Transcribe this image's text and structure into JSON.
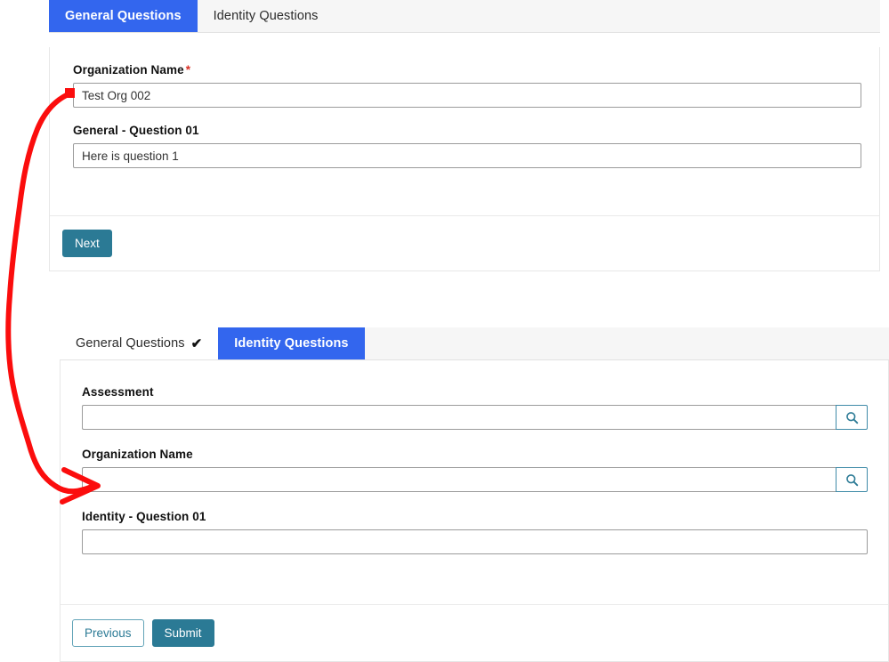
{
  "steps": [
    {
      "id": "general",
      "tabs": [
        {
          "label": "General Questions",
          "state": "active",
          "check": ""
        },
        {
          "label": "Identity Questions",
          "state": "inactive",
          "check": ""
        }
      ],
      "fields": [
        {
          "label": "Organization Name",
          "required": true,
          "required_marker": "*",
          "value": "Test Org 002",
          "placeholder": "",
          "lookup": false
        },
        {
          "label": "General - Question 01",
          "required": false,
          "required_marker": "",
          "value": "Here is question 1",
          "placeholder": "",
          "lookup": false
        }
      ],
      "buttons": [
        {
          "label": "Next",
          "style": "primary"
        }
      ]
    },
    {
      "id": "identity",
      "tabs": [
        {
          "label": "General Questions",
          "state": "visited",
          "check": "✔"
        },
        {
          "label": "Identity Questions",
          "state": "active",
          "check": ""
        }
      ],
      "fields": [
        {
          "label": "Assessment",
          "required": false,
          "required_marker": "",
          "value": "",
          "placeholder": "",
          "lookup": true,
          "lookup_icon": "search-icon"
        },
        {
          "label": "Organization Name",
          "required": false,
          "required_marker": "",
          "value": "",
          "placeholder": "",
          "lookup": true,
          "lookup_icon": "search-icon"
        },
        {
          "label": "Identity - Question 01",
          "required": false,
          "required_marker": "",
          "value": "",
          "placeholder": "",
          "lookup": false
        }
      ],
      "buttons": [
        {
          "label": "Previous",
          "style": "outline"
        },
        {
          "label": "Submit",
          "style": "primary"
        }
      ]
    }
  ],
  "annotation": {
    "type": "hand-drawn-arrow",
    "color": "#fb0d0d",
    "from": "general Organization Name input",
    "to": "identity Organization Name input"
  },
  "colors": {
    "tab_active_blue": "#3366ee",
    "button_teal": "#2b7a95",
    "required_red": "#d93025",
    "annotation_red": "#fb0d0d",
    "page_background": "#ffffff",
    "tabbar_background": "#f6f6f6"
  }
}
